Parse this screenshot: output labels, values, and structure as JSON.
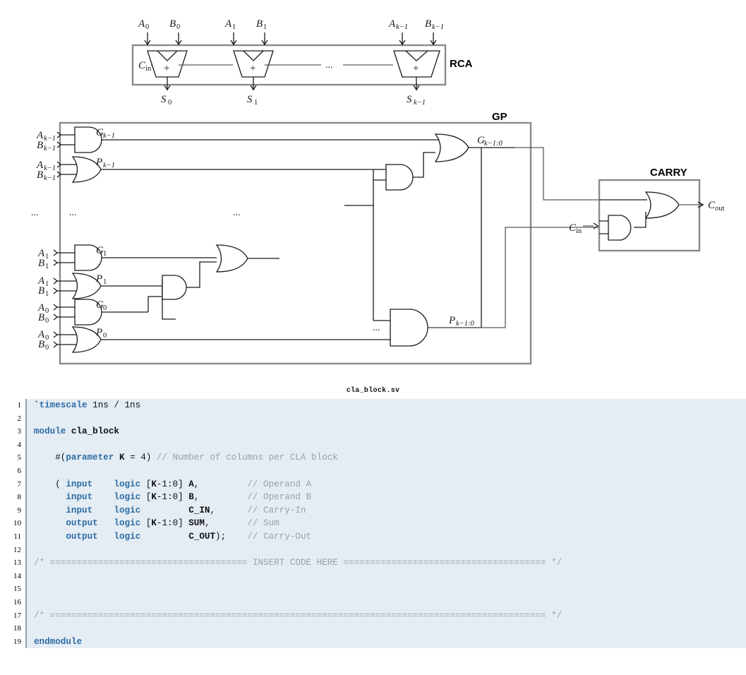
{
  "diagram": {
    "blocks": [
      {
        "name": "rca",
        "label": "RCA"
      },
      {
        "name": "gp",
        "label": "GP"
      },
      {
        "name": "carry",
        "label": "CARRY"
      }
    ],
    "rca": {
      "label": "RCA",
      "carry_in": "C",
      "carry_in_sub": "in",
      "adders": [
        {
          "a": "A",
          "a_sub": "0",
          "b": "B",
          "b_sub": "0",
          "s": "S",
          "s_sub": "0",
          "op": "+"
        },
        {
          "a": "A",
          "a_sub": "1",
          "b": "B",
          "b_sub": "1",
          "s": "S",
          "s_sub": "1",
          "op": "+"
        },
        {
          "a": "A",
          "a_sub": "k−1",
          "b": "B",
          "b_sub": "k−1",
          "s": "S",
          "s_sub": "k−1",
          "op": "+"
        }
      ],
      "ellipsis": "..."
    },
    "gp": {
      "label": "GP",
      "rows": [
        {
          "gate": "and",
          "in_a": "A",
          "in_a_sub": "k−1",
          "in_b": "B",
          "in_b_sub": "k−1",
          "out": "G",
          "out_sub": "k−1"
        },
        {
          "gate": "or",
          "in_a": "A",
          "in_a_sub": "k−1",
          "in_b": "B",
          "in_b_sub": "k−1",
          "out": "P",
          "out_sub": "k−1"
        },
        {
          "gate": "and",
          "in_a": "A",
          "in_a_sub": "1",
          "in_b": "B",
          "in_b_sub": "1",
          "out": "G",
          "out_sub": "1"
        },
        {
          "gate": "or",
          "in_a": "A",
          "in_a_sub": "1",
          "in_b": "B",
          "in_b_sub": "1",
          "out": "P",
          "out_sub": "1"
        },
        {
          "gate": "and",
          "in_a": "A",
          "in_a_sub": "0",
          "in_b": "B",
          "in_b_sub": "0",
          "out": "G",
          "out_sub": "0"
        },
        {
          "gate": "or",
          "in_a": "A",
          "in_a_sub": "0",
          "in_b": "B",
          "in_b_sub": "0",
          "out": "P",
          "out_sub": "0"
        }
      ],
      "outputs": [
        {
          "name": "group-generate",
          "sym": "G",
          "sub": "k−1:0"
        },
        {
          "name": "group-propagate",
          "sym": "P",
          "sub": "k−1:0"
        }
      ],
      "ellipsis": "..."
    },
    "carry": {
      "label": "CARRY",
      "carry_in": {
        "sym": "C",
        "sub": "in"
      },
      "carry_out": {
        "sym": "C",
        "sub": "out"
      }
    }
  },
  "code": {
    "title": "cla_block.sv",
    "language": "systemverilog",
    "line_numbers": [
      "1",
      "2",
      "3",
      "4",
      "5",
      "6",
      "7",
      "8",
      "9",
      "10",
      "11",
      "12",
      "13",
      "14",
      "15",
      "16",
      "17",
      "18",
      "19"
    ],
    "lines": [
      "`timescale 1ns / 1ns",
      "",
      "module cla_block",
      "",
      "    #(parameter K = 4) // Number of columns per CLA block",
      "",
      "    ( input    logic [K-1:0] A,         // Operand A",
      "      input    logic [K-1:0] B,         // Operand B",
      "      input    logic         C_IN,      // Carry-In",
      "      output   logic [K-1:0] SUM,       // Sum",
      "      output   logic         C_OUT);    // Carry-Out",
      "",
      "/* ===================================== INSERT CODE HERE ====================================== */",
      "",
      "",
      "",
      "/* ============================================================================================= */",
      "",
      "endmodule"
    ]
  },
  "colors": {
    "code_background": "#e4ecf4",
    "keyword": "#2e6da4",
    "comment": "#9aa0a6",
    "text": "#111111",
    "frame": "#8a8a8a",
    "wire": "#5a5a5a",
    "gate_outline": "#1a1a1a"
  }
}
